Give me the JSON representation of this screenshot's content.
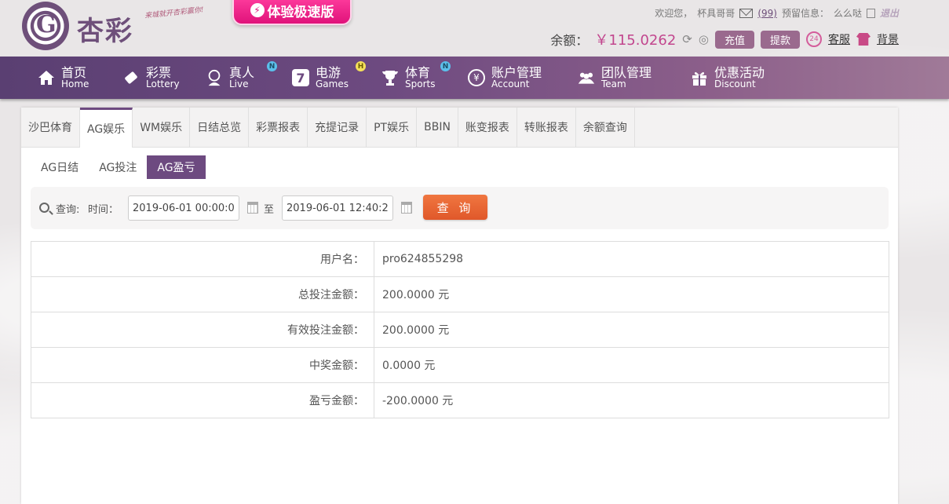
{
  "header": {
    "logo_text": "杏彩",
    "logo_slogan": "来城就开杏彩赢你!",
    "fast_version": "体验极速版",
    "welcome": "欢迎您，",
    "username": "杯具哥哥",
    "mail_count": "(99)",
    "reserve_label": "预留信息：",
    "reserve_value": "么么哒",
    "logout": "退出",
    "balance_label": "余额：",
    "balance_value": "￥115.0262",
    "deposit": "充值",
    "withdraw": "提款",
    "service_badge": "24",
    "service": "客服",
    "background": "背景"
  },
  "nav": [
    {
      "zh": "首页",
      "en": "Home",
      "icon": "home-icon"
    },
    {
      "zh": "彩票",
      "en": "Lottery",
      "icon": "ticket-icon"
    },
    {
      "zh": "真人",
      "en": "Live",
      "icon": "dealer-icon",
      "badge": "N"
    },
    {
      "zh": "电游",
      "en": "Games",
      "icon": "seven-icon",
      "badge": "H"
    },
    {
      "zh": "体育",
      "en": "Sports",
      "icon": "trophy-icon",
      "badge": "N"
    },
    {
      "zh": "账户管理",
      "en": "Account",
      "icon": "yen-icon"
    },
    {
      "zh": "团队管理",
      "en": "Team",
      "icon": "team-icon"
    },
    {
      "zh": "优惠活动",
      "en": "Discount",
      "icon": "gift-icon"
    }
  ],
  "tabs": [
    "沙巴体育",
    "AG娱乐",
    "WM娱乐",
    "日结总览",
    "彩票报表",
    "充提记录",
    "PT娱乐",
    "BBIN",
    "账变报表",
    "转账报表",
    "余额查询"
  ],
  "subtabs": [
    "AG日结",
    "AG投注",
    "AG盈亏"
  ],
  "query": {
    "label": "查询:",
    "time_label": "时间：",
    "start": "2019-06-01 00:00:00",
    "to": "至",
    "end": "2019-06-01 12:40:20",
    "button": "查 询"
  },
  "result": [
    {
      "key": "用户名：",
      "value": "pro624855298"
    },
    {
      "key": "总投注金额：",
      "value": "200.0000 元"
    },
    {
      "key": "有效投注金额：",
      "value": "200.0000 元"
    },
    {
      "key": "中奖金额：",
      "value": "0.0000 元"
    },
    {
      "key": "盈亏金额：",
      "value": "-200.0000 元"
    }
  ],
  "colors": {
    "accent": "#6d4a80",
    "balance": "#c2468e",
    "query_button": "#e8632f",
    "badge_n": "#5bc0eb",
    "badge_h": "#f5e15a"
  }
}
